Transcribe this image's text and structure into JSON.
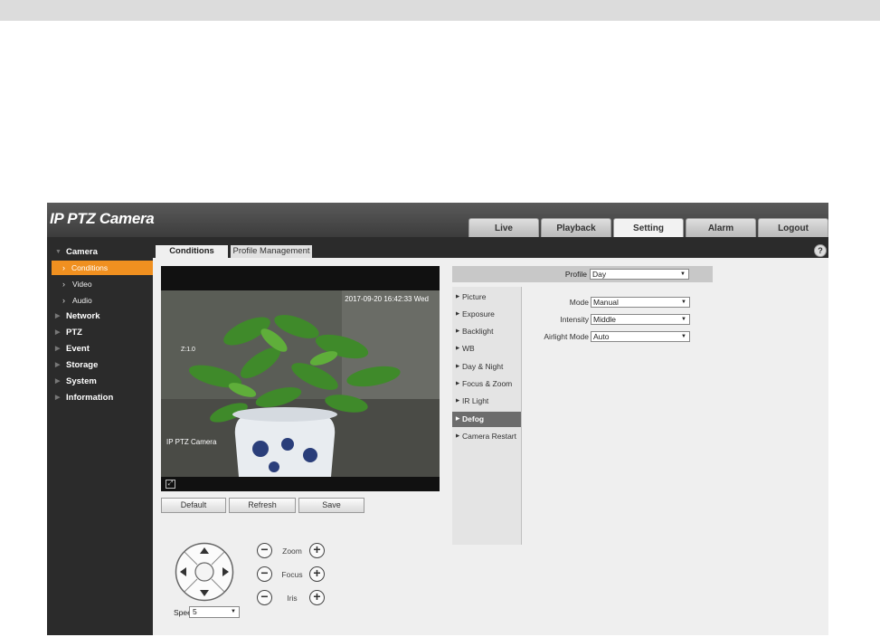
{
  "brand": "IP PTZ Camera",
  "nav_tabs": [
    "Live",
    "Playback",
    "Setting",
    "Alarm",
    "Logout"
  ],
  "active_nav": "Setting",
  "sidebar": {
    "camera": "Camera",
    "sub": [
      "Conditions",
      "Video",
      "Audio"
    ],
    "active_sub": "Conditions",
    "items": [
      "Network",
      "PTZ",
      "Event",
      "Storage",
      "System",
      "Information"
    ]
  },
  "content_tabs": {
    "active": "Conditions",
    "other": "Profile Management"
  },
  "video": {
    "timestamp": "2017-09-20 16:42:33 Wed",
    "zoom_label": "Z:1.0",
    "camera_label": "IP PTZ Camera"
  },
  "buttons": {
    "default": "Default",
    "refresh": "Refresh",
    "save": "Save"
  },
  "ptz": {
    "zoom": "Zoom",
    "focus": "Focus",
    "iris": "Iris",
    "speed_label": "Speed",
    "speed_value": "5"
  },
  "profile": {
    "label": "Profile",
    "value": "Day"
  },
  "menu": [
    "Picture",
    "Exposure",
    "Backlight",
    "WB",
    "Day & Night",
    "Focus & Zoom",
    "IR Light",
    "Defog",
    "Camera Restart"
  ],
  "menu_active": "Defog",
  "fields": {
    "mode_label": "Mode",
    "mode_value": "Manual",
    "intensity_label": "Intensity",
    "intensity_value": "Middle",
    "airlight_label": "Airlight Mode",
    "airlight_value": "Auto"
  }
}
